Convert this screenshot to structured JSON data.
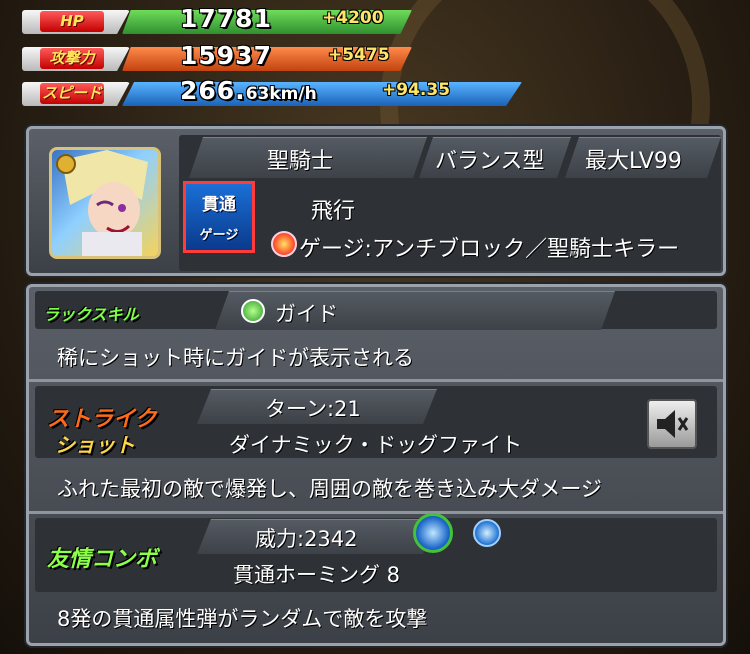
{
  "stats": {
    "hp": {
      "label": "HP",
      "value": "17781",
      "bonus": "+4200",
      "color": "#3fae3f"
    },
    "attack": {
      "label": "攻撃力",
      "value": "15937",
      "bonus": "+5475",
      "color": "#e8622a"
    },
    "speed": {
      "label": "スピード",
      "value_main": "266.",
      "value_small": "63km/h",
      "bonus": "+94.35",
      "color": "#2f8ee0"
    }
  },
  "profile": {
    "race": "聖騎士",
    "type": "バランス型",
    "max_level": "最大LV99",
    "movement": "飛行",
    "badge_top": "貫通",
    "badge_bottom": "ゲージ",
    "abilities": "ゲージ:アンチブロック／聖騎士キラー"
  },
  "luck_skill": {
    "label": "ラックスキル",
    "name": "ガイド",
    "description": "稀にショット時にガイドが表示される"
  },
  "strike_shot": {
    "label_line1": "ストライク",
    "label_line2": "ショット",
    "turns": "ターン:21",
    "name": "ダイナミック・ドッグファイト",
    "description": "ふれた最初の敵で爆発し、周囲の敵を巻き込み大ダメージ"
  },
  "friend_combo": {
    "label": "友情コンボ",
    "power": "威力:2342",
    "name": "貫通ホーミング 8",
    "description": "8発の貫通属性弾がランダムで敵を攻撃"
  },
  "icons": {
    "luck": "crosshair-icon",
    "element": "flame-icon",
    "combo_large": "piercing-homing-icon",
    "combo_small": "mini-homing-icon",
    "speaker": "speaker-mute-icon"
  }
}
